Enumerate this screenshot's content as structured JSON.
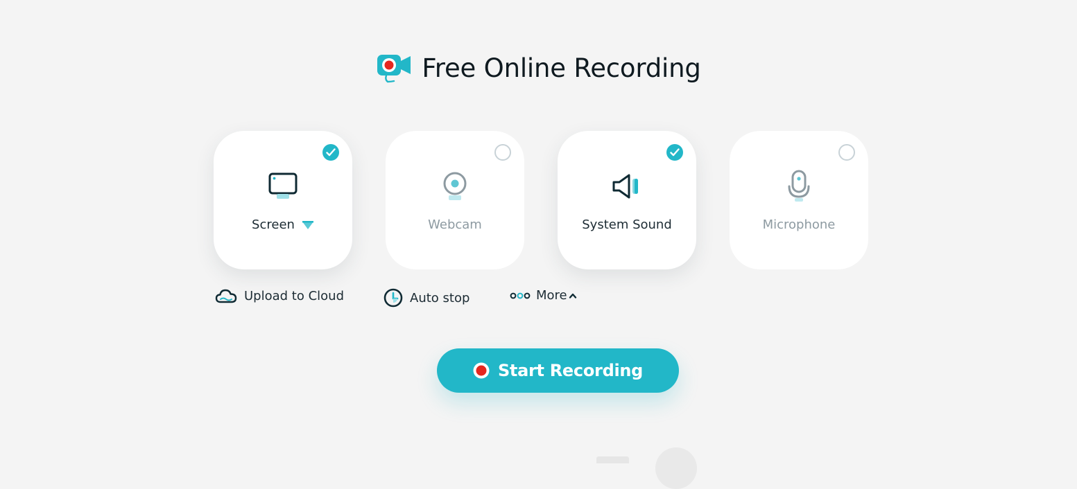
{
  "header": {
    "title": "Free Online Recording",
    "logo_icon": "video-camera-record-icon"
  },
  "sources": [
    {
      "key": "screen",
      "label": "Screen",
      "checked": true,
      "icon": "monitor-icon",
      "has_dropdown": true
    },
    {
      "key": "webcam",
      "label": "Webcam",
      "checked": false,
      "icon": "webcam-icon"
    },
    {
      "key": "system_sound",
      "label": "System Sound",
      "checked": true,
      "icon": "speaker-icon"
    },
    {
      "key": "microphone",
      "label": "Microphone",
      "checked": false,
      "icon": "microphone-icon"
    }
  ],
  "options": {
    "upload": {
      "label": "Upload to Cloud",
      "icon": "cloud-icon"
    },
    "autostop": {
      "label": "Auto stop",
      "icon": "clock-icon"
    },
    "more": {
      "label": "More",
      "icon": "dots-icon",
      "chevron": "chevron-up-icon"
    }
  },
  "start_button": {
    "label": "Start Recording",
    "icon": "record-dot-icon"
  },
  "colors": {
    "accent": "#22b7c8",
    "record_red": "#e5271f",
    "background": "#f4f4f4",
    "text_dark": "#1c2b33",
    "text_muted": "#8d9aa1"
  }
}
